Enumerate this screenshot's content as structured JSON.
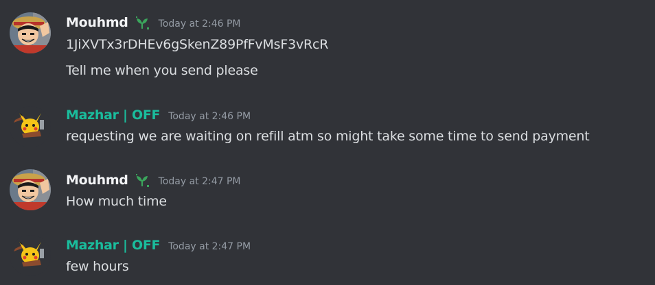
{
  "colors": {
    "background": "#313338",
    "text": "#dbdee1",
    "timestamp": "#949ba4",
    "mouhmd_name": "#f2f3f5",
    "mazhar_name": "#1abc9c",
    "badge_green": "#3ba55c"
  },
  "messages": [
    {
      "author": "Mouhmd",
      "badge_icon": "sprout-icon",
      "timestamp": "Today at 2:46 PM",
      "lines": [
        "1JiXVTx3rDHEv6gSkenZ89PfFvMsF3vRcR",
        "Tell me when you send please"
      ]
    },
    {
      "author": "Mazhar | OFF",
      "timestamp": "Today at 2:46 PM",
      "lines": [
        "requesting we are waiting on refill atm so might take some time to send payment"
      ]
    },
    {
      "author": "Mouhmd",
      "badge_icon": "sprout-icon",
      "timestamp": "Today at 2:47 PM",
      "lines": [
        "How much time"
      ]
    },
    {
      "author": "Mazhar | OFF",
      "timestamp": "Today at 2:47 PM",
      "lines": [
        "few hours"
      ]
    }
  ]
}
